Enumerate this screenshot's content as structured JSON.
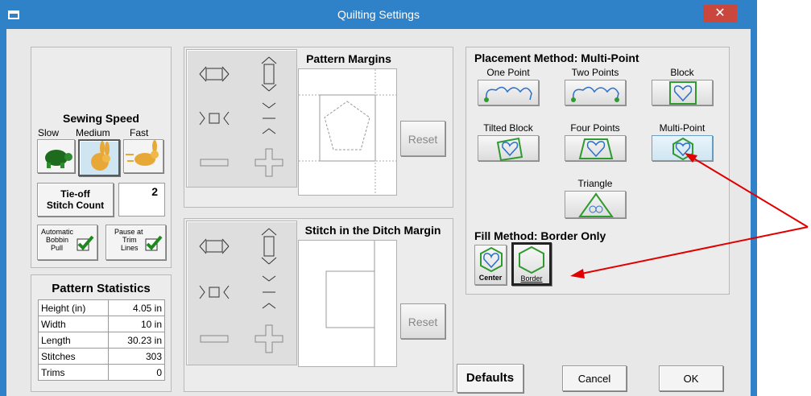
{
  "window": {
    "title": "Quilting Settings",
    "close_glyph": "✕"
  },
  "sewing_speed": {
    "title": "Sewing Speed",
    "labels": [
      "Slow",
      "Medium",
      "Fast"
    ],
    "selected": "Medium"
  },
  "tieoff": {
    "label_line1": "Tie-off",
    "label_line2": "Stitch Count",
    "value": "2"
  },
  "checks": {
    "bobbin": {
      "l1": "Automatic",
      "l2": "Bobbin",
      "l3": "Pull",
      "checked": true
    },
    "pause": {
      "l1": "Pause at",
      "l2": "Trim",
      "l3": "Lines",
      "checked": true
    }
  },
  "stats": {
    "title": "Pattern Statistics",
    "rows": [
      {
        "label": "Height (in)",
        "value": "4.05 in"
      },
      {
        "label": "Width",
        "value": "10 in"
      },
      {
        "label": "Length",
        "value": "30.23 in"
      },
      {
        "label": "Stitches",
        "value": "303"
      },
      {
        "label": "Trims",
        "value": "0"
      }
    ]
  },
  "pattern_margins": {
    "title": "Pattern Margins",
    "reset": "Reset"
  },
  "sitd_margin": {
    "title": "Stitch in the Ditch Margin",
    "reset": "Reset"
  },
  "placement": {
    "title": "Placement Method: Multi-Point",
    "options": [
      {
        "label": "One Point"
      },
      {
        "label": "Two Points"
      },
      {
        "label": "Block"
      },
      {
        "label": "Tilted Block"
      },
      {
        "label": "Four Points"
      },
      {
        "label": "Multi-Point",
        "selected": true
      },
      {
        "label": "Triangle"
      }
    ]
  },
  "fill": {
    "title": "Fill Method: Border Only",
    "center": "Center",
    "border": "Border"
  },
  "buttons": {
    "defaults": "Defaults",
    "cancel": "Cancel",
    "ok": "OK"
  },
  "colors": {
    "title_bar": "#2f81c8",
    "close": "#c9473d",
    "arrow": "#e00000",
    "accent": "#2f9a2f"
  }
}
